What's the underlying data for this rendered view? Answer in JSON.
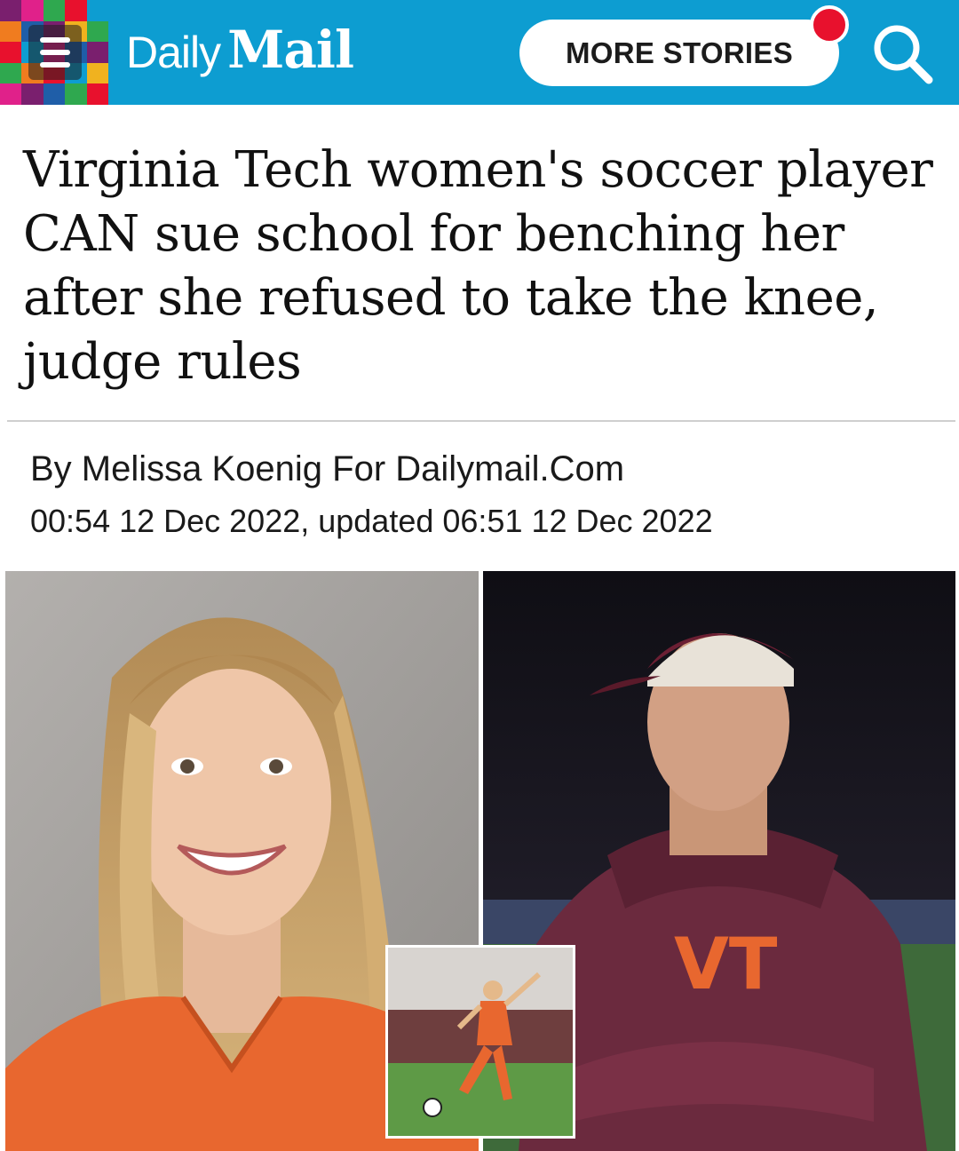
{
  "header": {
    "logo_daily": "Daily",
    "logo_mail": "Mail",
    "more_stories_label": "MORE STORIES",
    "brand_color": "#0d9dd1",
    "notification_color": "#e8112d"
  },
  "article": {
    "headline": "Virginia Tech women's soccer player CAN sue school for benching her after she refused to take the knee, judge rules",
    "byline": "By Melissa Koenig For Dailymail.Com",
    "dateline": "00:54 12 Dec 2022, updated 06:51 12 Dec 2022"
  },
  "icons": {
    "menu": "hamburger-menu-icon",
    "search": "search-icon",
    "notification": "notification-dot-icon"
  },
  "images": {
    "left": "player-portrait",
    "right": "coach-portrait",
    "inset": "player-kicking-ball"
  }
}
